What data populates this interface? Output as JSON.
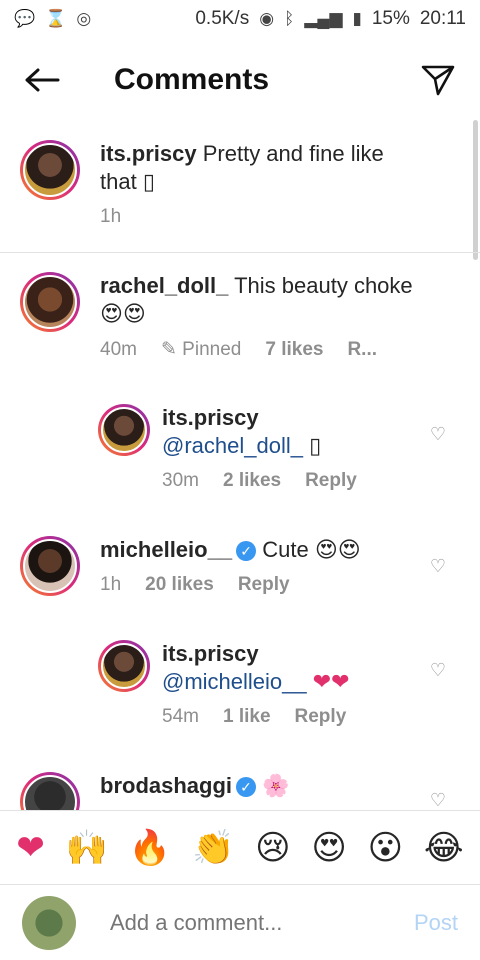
{
  "status_bar": {
    "speed": "0.5K/s",
    "battery": "15%",
    "time": "20:11"
  },
  "header": {
    "title": "Comments"
  },
  "comments": [
    {
      "username": "its.priscy",
      "text": "Pretty and fine like that",
      "extra": "▯",
      "time": "1h"
    },
    {
      "username": "rachel_doll_",
      "text": "This beauty choke",
      "extra": "😍😍",
      "time": "40m",
      "pinned": "Pinned",
      "likes": "7 likes",
      "reply": "R..."
    },
    {
      "username": "its.priscy",
      "text": "@rachel_doll_",
      "extra": "▯",
      "time": "30m",
      "likes": "2 likes",
      "reply": "Reply"
    },
    {
      "username": "michelleio__",
      "text": "Cute",
      "extra": "😍😍",
      "time": "1h",
      "likes": "20 likes",
      "reply": "Reply"
    },
    {
      "username": "its.priscy",
      "text": "@michelleio__",
      "extra": "❤❤",
      "time": "54m",
      "likes": "1 like",
      "reply": "Reply"
    },
    {
      "username": "brodashaggi",
      "text": "",
      "extra": "🌸"
    }
  ],
  "reactions": [
    "❤",
    "🙌",
    "🔥",
    "👏",
    "😢",
    "😍",
    "😮",
    "😂"
  ],
  "composer": {
    "placeholder": "Add a comment...",
    "post": "Post"
  },
  "colors": {
    "mention": "#1f4e8c",
    "verified": "#3897f0",
    "post_disabled": "#b3d4f5"
  }
}
